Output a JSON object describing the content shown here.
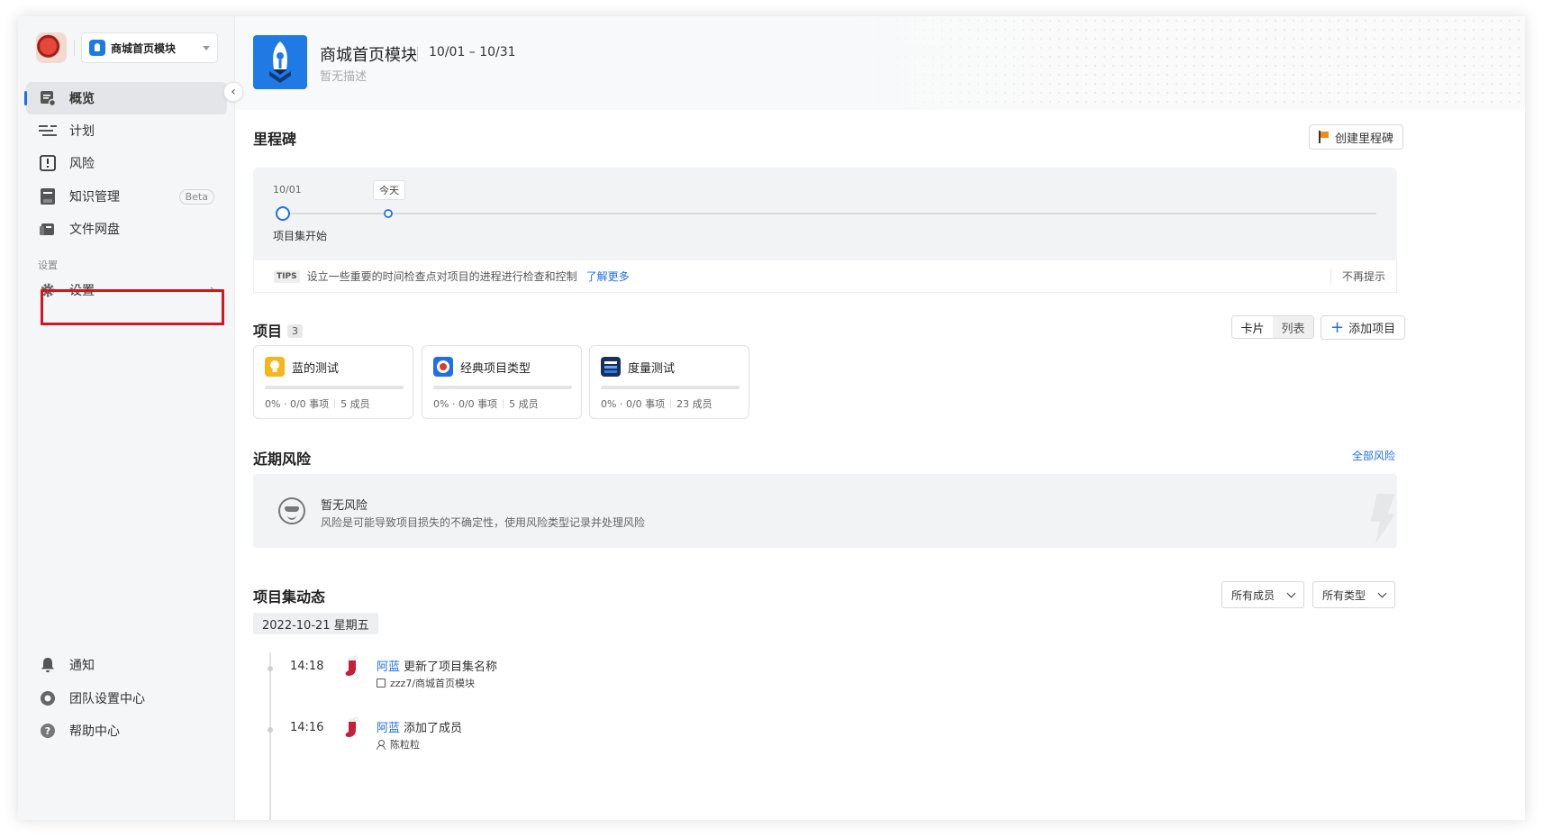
{
  "sidebar": {
    "workspace": "商城首页模块",
    "nav": [
      {
        "label": "概览"
      },
      {
        "label": "计划"
      },
      {
        "label": "风险"
      },
      {
        "label": "知识管理",
        "badge": "Beta"
      },
      {
        "label": "文件网盘"
      }
    ],
    "section_label": "设置",
    "settings_label": "设置",
    "bottom": [
      {
        "label": "通知"
      },
      {
        "label": "团队设置中心"
      },
      {
        "label": "帮助中心"
      }
    ]
  },
  "header": {
    "title": "商城首页模块",
    "date_range": "10/01 – 10/31",
    "description": "暂无描述"
  },
  "milestone": {
    "title": "里程碑",
    "create_button": "创建里程碑",
    "start_date": "10/01",
    "today_label": "今天",
    "start_label": "项目集开始",
    "tips_badge": "TIPS",
    "tips_text": "设立一些重要的时间检查点对项目的进程进行检查和控制",
    "learn_more": "了解更多",
    "dismiss": "不再提示"
  },
  "projects": {
    "title": "项目",
    "count": "3",
    "view_card": "卡片",
    "view_list": "列表",
    "add_button": "添加项目",
    "items": [
      {
        "name": "蓝的测试",
        "progress": "0%",
        "items": "0/0 事项",
        "members": "5 成员",
        "progress_fraction": 0
      },
      {
        "name": "经典项目类型",
        "progress": "0%",
        "items": "0/0 事项",
        "members": "5 成员",
        "progress_fraction": 0
      },
      {
        "name": "度量测试",
        "progress": "0%",
        "items": "0/0 事项",
        "members": "23 成员",
        "progress_fraction": 0
      }
    ]
  },
  "risks": {
    "title": "近期风险",
    "all_link": "全部风险",
    "empty_title": "暂无风险",
    "empty_desc": "风险是可能导致项目损失的不确定性，使用风险类型记录并处理风险"
  },
  "activity": {
    "title": "项目集动态",
    "filter_members": "所有成员",
    "filter_types": "所有类型",
    "date": "2022-10-21 星期五",
    "entries": [
      {
        "time": "14:18",
        "user": "阿蓝",
        "action": "更新了项目集名称",
        "detail": "zzz7/商城首页模块"
      },
      {
        "time": "14:16",
        "user": "阿蓝",
        "action": "添加了成员",
        "detail": "陈粒粒"
      }
    ]
  },
  "colors": {
    "accent": "#1f6fe5",
    "highlight_border": "#d4141f",
    "logo_bg": "#1f7ae6"
  }
}
